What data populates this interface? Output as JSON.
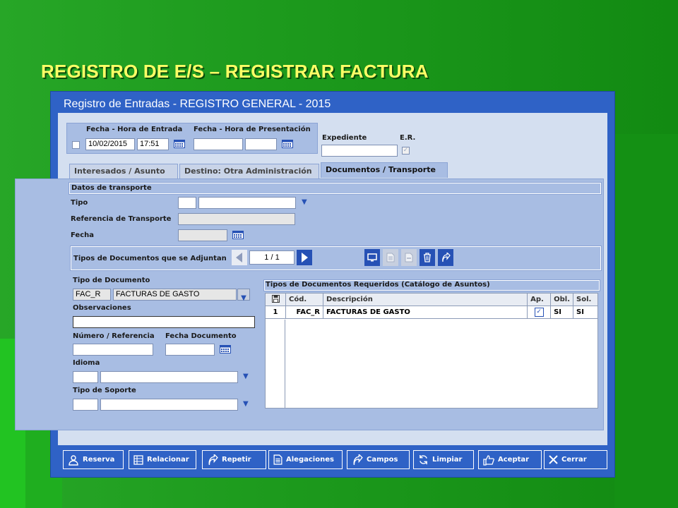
{
  "slide_title": "REGISTRO DE E/S – REGISTRAR FACTURA",
  "window_title": "Registro de Entradas - REGISTRO GENERAL - 2015",
  "entry": {
    "entrada_label": "Fecha - Hora de Entrada",
    "presentacion_label": "Fecha - Hora de Presentación",
    "entrada_date": "10/02/2015",
    "entrada_time": "17:51",
    "presentacion_date": "",
    "presentacion_time": ""
  },
  "expediente_label": "Expediente",
  "er_label": "E.R.",
  "tabs": [
    {
      "label": "Interesados / Asunto",
      "active": false
    },
    {
      "label": "Destino: Otra Administración",
      "active": false
    },
    {
      "label": "Documentos / Transporte",
      "active": true
    }
  ],
  "transport": {
    "section_title": "Datos de transporte",
    "tipo_label": "Tipo",
    "referencia_label": "Referencia de Transporte",
    "fecha_label": "Fecha"
  },
  "adjuntos": {
    "label": "Tipos de Documentos que se Adjuntan",
    "pager": "1 / 1"
  },
  "document": {
    "tipo_label": "Tipo de Documento",
    "tipo_code": "FAC_R",
    "tipo_desc": "FACTURAS DE GASTO",
    "observaciones_label": "Observaciones",
    "numero_label": "Número / Referencia",
    "fecha_doc_label": "Fecha Documento",
    "idioma_label": "Idioma",
    "soporte_label": "Tipo de Soporte"
  },
  "required": {
    "title": "Tipos de Documentos Requeridos (Catálogo de Asuntos)",
    "columns": [
      "Cód.",
      "Descripción",
      "Ap.",
      "Obl.",
      "Sol."
    ],
    "rows": [
      {
        "index": "1",
        "code": "FAC_R",
        "desc": "FACTURAS DE GASTO",
        "ap": true,
        "obl": "SI",
        "sol": "SI"
      }
    ]
  },
  "buttons": [
    "Reserva",
    "Relacionar",
    "Repetir",
    "Alegaciones",
    "Campos",
    "Limpiar",
    "Aceptar",
    "Cerrar"
  ],
  "colors": {
    "background": "#1d9a1d",
    "title": "#ffff66",
    "window": "#2f62c6",
    "panel": "#a8bde3"
  }
}
